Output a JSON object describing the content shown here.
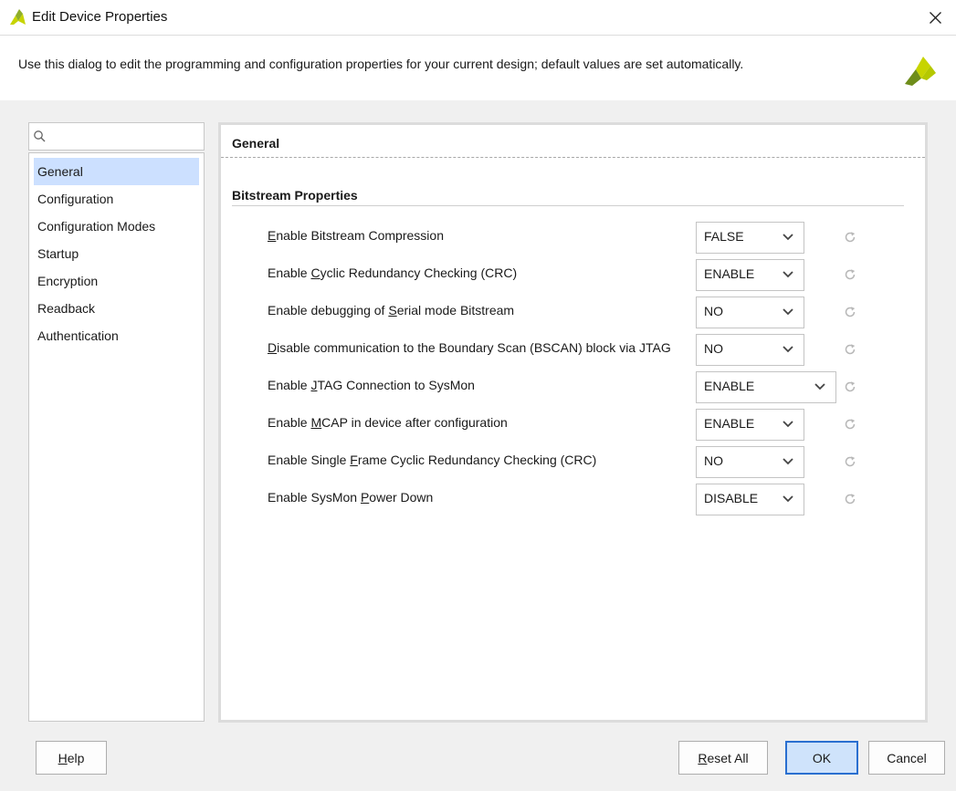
{
  "window": {
    "title": "Edit Device Properties"
  },
  "header": {
    "description": "Use this dialog to edit the programming and configuration properties for your current design; default values are set automatically."
  },
  "search": {
    "placeholder": "",
    "value": ""
  },
  "nav": {
    "items": [
      {
        "label": "General",
        "selected": true
      },
      {
        "label": "Configuration"
      },
      {
        "label": "Configuration Modes"
      },
      {
        "label": "Startup"
      },
      {
        "label": "Encryption"
      },
      {
        "label": "Readback"
      },
      {
        "label": "Authentication"
      }
    ]
  },
  "content": {
    "section_title": "General",
    "group_title": "Bitstream Properties",
    "properties": [
      {
        "pre": "",
        "mn": "E",
        "post": "nable Bitstream Compression",
        "value": "FALSE"
      },
      {
        "pre": "Enable ",
        "mn": "C",
        "post": "yclic Redundancy Checking (CRC)",
        "value": "ENABLE"
      },
      {
        "pre": "Enable debugging of ",
        "mn": "S",
        "post": "erial mode Bitstream",
        "value": "NO"
      },
      {
        "pre": "",
        "mn": "D",
        "post": "isable communication to the Boundary Scan (BSCAN) block via JTAG",
        "value": "NO"
      },
      {
        "pre": "Enable ",
        "mn": "J",
        "post": "TAG Connection to SysMon",
        "value": "ENABLE"
      },
      {
        "pre": "Enable ",
        "mn": "M",
        "post": "CAP in device after configuration",
        "value": "ENABLE"
      },
      {
        "pre": "Enable Single ",
        "mn": "F",
        "post": "rame Cyclic Redundancy Checking (CRC)",
        "value": "NO"
      },
      {
        "pre": "Enable SysMon ",
        "mn": "P",
        "post": "ower Down",
        "value": "DISABLE"
      }
    ]
  },
  "buttons": {
    "help": {
      "mn": "H",
      "rest": "elp"
    },
    "reset_all": {
      "mn": "R",
      "rest": "eset All"
    },
    "ok": "OK",
    "cancel": "Cancel"
  },
  "colors": {
    "selection": "#cce0ff",
    "logo_yellow": "#c7d400",
    "logo_green": "#6e8d1a",
    "primary_border": "#2a6fd0"
  },
  "icons": {
    "app": "xilinx-logo-icon",
    "close": "close-icon",
    "search": "search-icon",
    "dropdown": "chevron-down-icon",
    "reset": "reset-default-icon"
  }
}
